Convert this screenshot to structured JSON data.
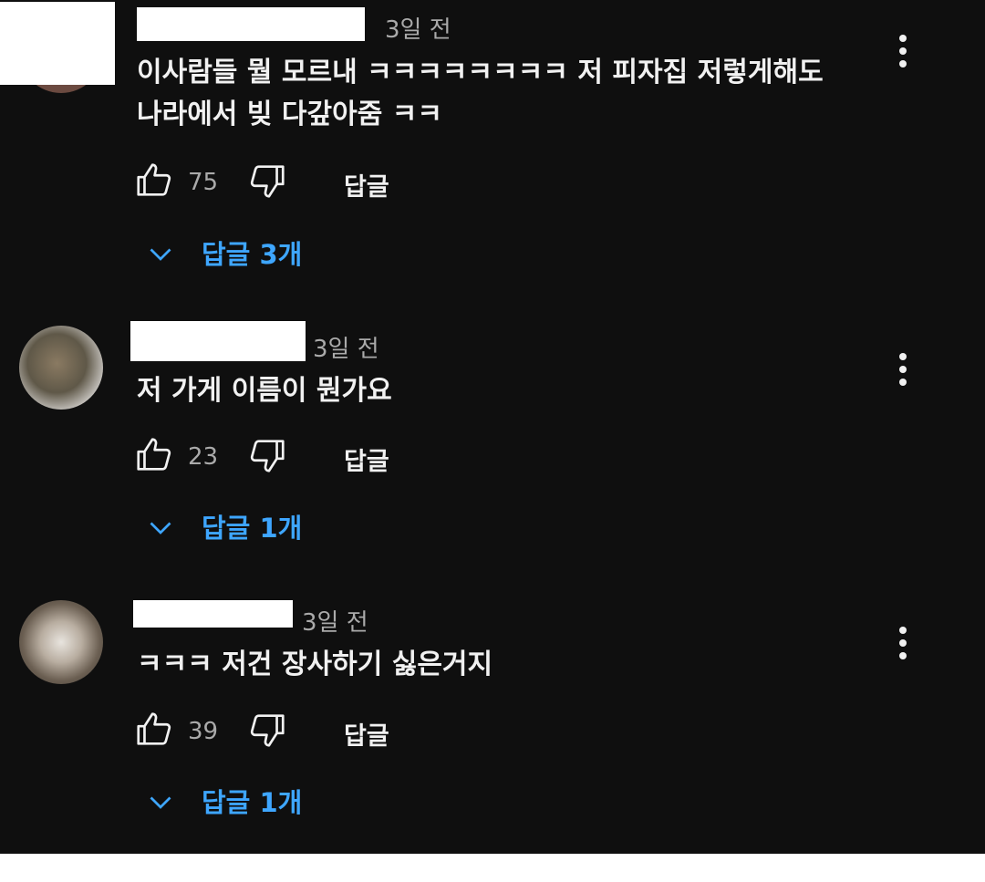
{
  "colors": {
    "background": "#0f0f0f",
    "text_primary": "#f1f1f1",
    "text_secondary": "#aaaaaa",
    "link_blue": "#3ea6ff"
  },
  "comments": [
    {
      "time": "3일 전",
      "text": "이사람들 뭘 모르내 ㅋㅋㅋㅋㅋㅋㅋㅋ 저 피자집 저렇게해도 나라에서 빚 다갚아줌 ㅋㅋ",
      "likes": "75",
      "reply_label": "답글",
      "replies_label": "답글 3개",
      "icons": [
        "thumb-up-icon",
        "thumb-down-icon",
        "more-vert-icon",
        "chevron-down-icon"
      ]
    },
    {
      "time": "3일 전",
      "text": "저 가게 이름이 뭔가요",
      "likes": "23",
      "reply_label": "답글",
      "replies_label": "답글 1개",
      "icons": [
        "thumb-up-icon",
        "thumb-down-icon",
        "more-vert-icon",
        "chevron-down-icon"
      ]
    },
    {
      "time": "3일 전",
      "text": "ㅋㅋㅋ 저건 장사하기 싫은거지",
      "likes": "39",
      "reply_label": "답글",
      "replies_label": "답글 1개",
      "icons": [
        "thumb-up-icon",
        "thumb-down-icon",
        "more-vert-icon",
        "chevron-down-icon"
      ]
    }
  ]
}
